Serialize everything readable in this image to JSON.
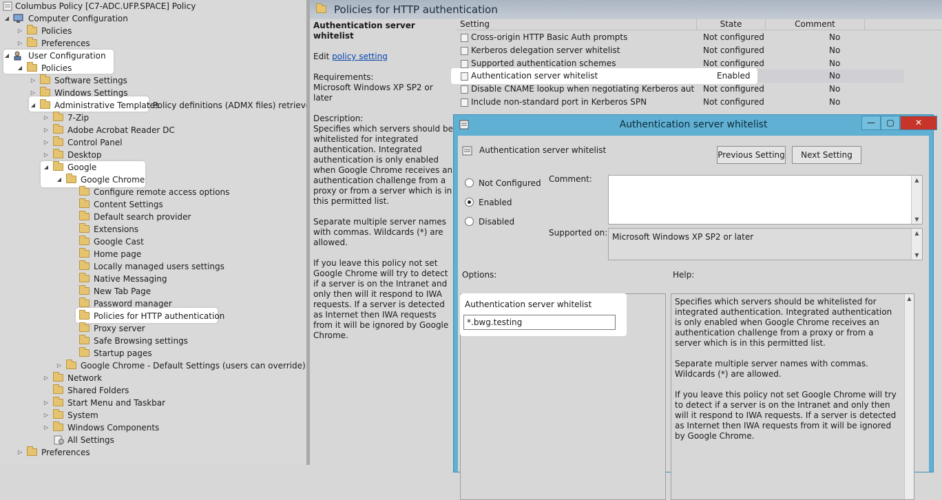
{
  "tree": {
    "title": "Columbus Policy [C7-ADC.UFP.SPACE] Policy",
    "computer_configuration": "Computer Configuration",
    "cc_policies": "Policies",
    "cc_preferences": "Preferences",
    "user_configuration": "User Configuration",
    "uc_policies": "Policies",
    "software_settings": "Software Settings",
    "windows_settings": "Windows Settings",
    "administrative_templates": "Administrative Templates",
    "admin_templates_suffix": ": Policy definitions (ADMX files) retrieved fro",
    "seven_zip": "7-Zip",
    "adobe": "Adobe Acrobat Reader DC",
    "control_panel": "Control Panel",
    "desktop": "Desktop",
    "google": "Google",
    "google_chrome": "Google Chrome",
    "chrome_children": [
      "Configure remote access options",
      "Content Settings",
      "Default search provider",
      "Extensions",
      "Google Cast",
      "Home page",
      "Locally managed users settings",
      "Native Messaging",
      "New Tab Page",
      "Password manager",
      "Policies for HTTP authentication",
      "Proxy server",
      "Safe Browsing settings",
      "Startup pages"
    ],
    "chrome_default": "Google Chrome - Default Settings (users can override)",
    "network": "Network",
    "shared_folders": "Shared Folders",
    "start_menu": "Start Menu and Taskbar",
    "system": "System",
    "windows_components": "Windows Components",
    "all_settings": "All Settings",
    "uc_preferences": "Preferences"
  },
  "pane": {
    "title": "Policies for HTTP authentication"
  },
  "description": {
    "heading": "Authentication server whitelist",
    "edit_prefix": "Edit ",
    "edit_link": "policy setting ",
    "requirements_label": "Requirements:",
    "requirements_value": "Microsoft Windows XP SP2 or later",
    "description_label": "Description:",
    "paragraphs": [
      "Specifies which servers should be whitelisted for integrated authentication. Integrated authentication is only enabled when Google Chrome receives an authentication challenge from a proxy or from a server which is in this permitted list.",
      "Separate multiple server names with commas. Wildcards (*) are allowed.",
      "If you leave this policy not set Google Chrome will try to detect if a server is on the Intranet and only then will it respond to IWA requests.  If a server is detected as Internet then IWA requests from it will be ignored by Google Chrome."
    ]
  },
  "list": {
    "columns": [
      "Setting",
      "State",
      "Comment"
    ],
    "rows": [
      {
        "setting": "Cross-origin HTTP Basic Auth prompts",
        "state": "Not configured",
        "comment": "No"
      },
      {
        "setting": "Kerberos delegation server whitelist",
        "state": "Not configured",
        "comment": "No"
      },
      {
        "setting": "Supported authentication schemes",
        "state": "Not configured",
        "comment": "No"
      },
      {
        "setting": "Authentication server whitelist",
        "state": "Enabled",
        "comment": "No"
      },
      {
        "setting": "Disable CNAME lookup when negotiating Kerberos authenti...",
        "state": "Not configured",
        "comment": "No"
      },
      {
        "setting": "Include non-standard port in Kerberos SPN",
        "state": "Not configured",
        "comment": "No"
      }
    ]
  },
  "dialog": {
    "title": "Authentication server whitelist",
    "setting_name": "Authentication server whitelist",
    "prev_button": "Previous Setting",
    "next_button": "Next Setting",
    "radio_not_configured": "Not Configured",
    "radio_enabled": "Enabled",
    "radio_disabled": "Disabled",
    "selected": "Enabled",
    "comment_label": "Comment:",
    "supported_label": "Supported on:",
    "supported_value": "Microsoft Windows XP SP2 or later",
    "options_label": "Options:",
    "help_label": "Help:",
    "option_field_label": "Authentication server whitelist",
    "option_field_value": "*.bwg.testing",
    "help_paragraphs": [
      "Specifies which servers should be whitelisted for integrated authentication. Integrated authentication is only enabled when Google Chrome receives an authentication challenge from a proxy or from a server which is in this permitted list.",
      "Separate multiple server names with commas. Wildcards (*) are allowed.",
      "If you leave this policy not set Google Chrome will try to detect if a server is on the Intranet and only then will it respond to IWA requests.  If a server is detected as Internet then IWA requests from it will be ignored by Google Chrome."
    ]
  },
  "icons": {
    "expand": "triangle-right-icon",
    "collapse": "triangle-down-icon",
    "folder": "folder-icon",
    "policy": "policy-icon",
    "computer": "computer-icon",
    "user": "user-icon",
    "setting": "setting-icon"
  },
  "colors": {
    "dialog_frame": "#5fb0d3",
    "close_button": "#c6342a",
    "highlight": "#ffffff"
  }
}
